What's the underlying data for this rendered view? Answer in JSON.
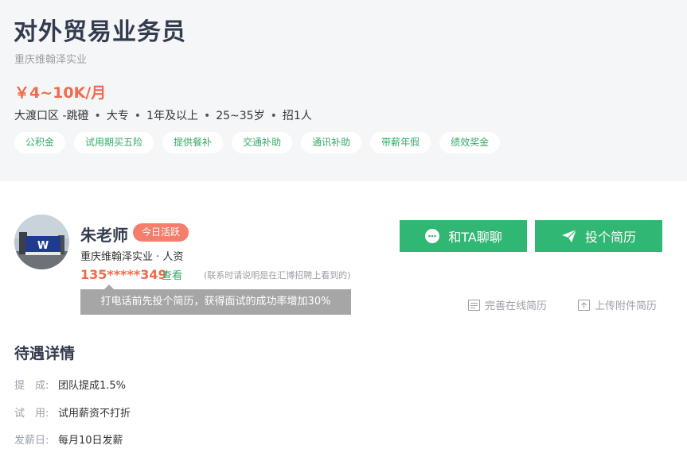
{
  "job": {
    "title": "对外贸易业务员",
    "company": "重庆维翰泽实业",
    "salary": "￥4~10K/月",
    "meta": [
      "大渡口区 -跳磴",
      "大专",
      "1年及以上",
      "25~35岁",
      "招1人"
    ],
    "benefits": [
      "公积金",
      "试用期买五险",
      "提供餐补",
      "交通补助",
      "通讯补助",
      "带薪年假",
      "绩效奖金"
    ]
  },
  "recruiter": {
    "name": "朱老师",
    "badge": "今日活跃",
    "company_role": "重庆维翰泽实业 · 人资",
    "phone": "135*****349",
    "view_label": "查看",
    "note": "(联系时请说明是在汇博招聘上看到的)",
    "tip": "打电话前先投个简历，获得面试的成功率增加30%"
  },
  "actions": {
    "chat_label": "和TA聊聊",
    "resume_label": "投个简历",
    "online_resume": "完善在线简历",
    "upload_resume": "上传附件简历"
  },
  "benefit_detail": {
    "title": "待遇详情",
    "rows": [
      {
        "key": "提　成:",
        "value": "团队提成1.5%"
      },
      {
        "key": "试　用:",
        "value": "试用薪资不打折"
      },
      {
        "key": "发薪日:",
        "value": "每月10日发薪"
      }
    ]
  },
  "icons": {
    "chat": "chat-bubble-icon",
    "send": "paper-plane-icon",
    "resume": "document-icon",
    "upload": "upload-icon"
  },
  "colors": {
    "accent_green": "#30b773",
    "salary_red": "#f06a4b",
    "badge": "#f47e6b"
  }
}
